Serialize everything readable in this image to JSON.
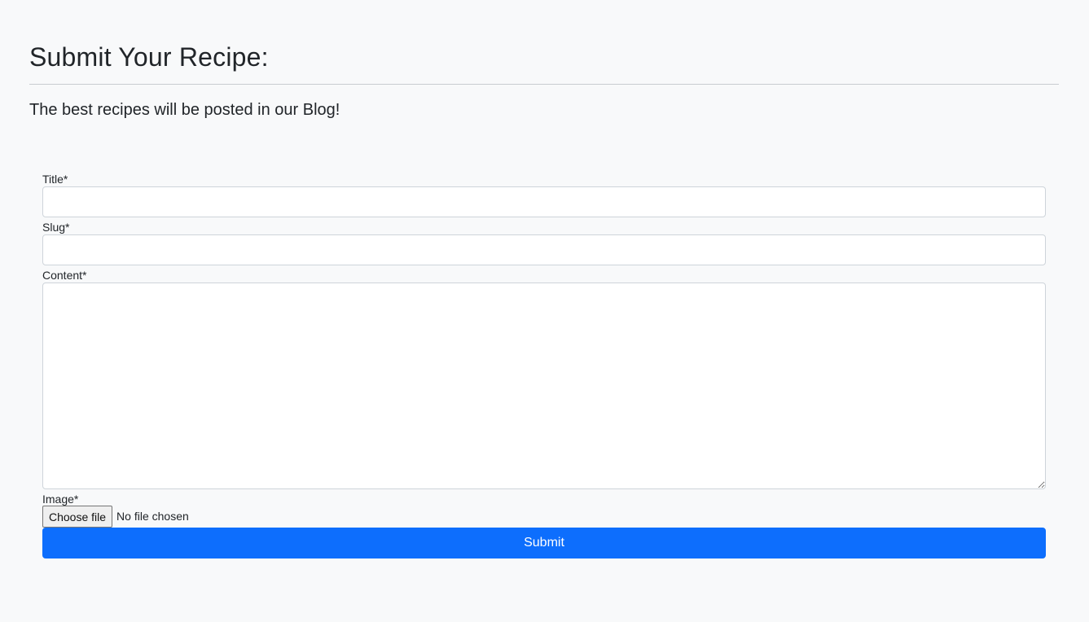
{
  "header": {
    "title": "Submit Your Recipe:",
    "subtitle": "The best recipes will be posted in our Blog!"
  },
  "form": {
    "title_label": "Title*",
    "title_value": "",
    "slug_label": "Slug*",
    "slug_value": "",
    "content_label": "Content*",
    "content_value": "",
    "image_label": "Image*",
    "choose_file_label": "Choose file",
    "file_status": "No file chosen",
    "submit_label": "Submit"
  },
  "colors": {
    "background": "#f8f9fa",
    "primary_button": "#0d6efd",
    "border": "#ced4da"
  }
}
